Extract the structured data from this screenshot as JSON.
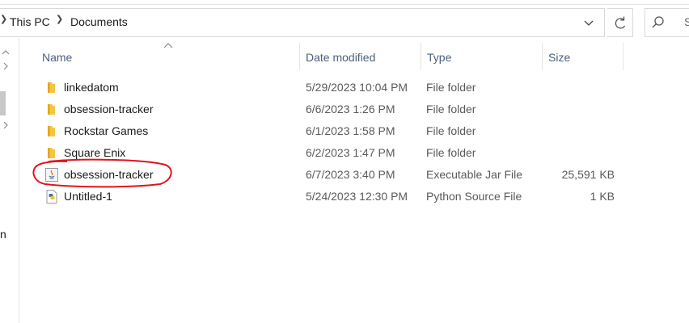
{
  "address_bar": {
    "breadcrumbs": [
      "This PC",
      "Documents"
    ]
  },
  "search": {
    "placeholder": "S"
  },
  "nav_pane": {
    "partial_letter": "n"
  },
  "columns": {
    "name": "Name",
    "date_modified": "Date modified",
    "type": "Type",
    "size": "Size"
  },
  "files": [
    {
      "name": "linkedatom",
      "date": "5/29/2023 10:04 PM",
      "type": "File folder",
      "size": "",
      "icon": "folder-icon"
    },
    {
      "name": "obsession-tracker",
      "date": "6/6/2023 1:26 PM",
      "type": "File folder",
      "size": "",
      "icon": "folder-icon"
    },
    {
      "name": "Rockstar Games",
      "date": "6/1/2023 1:58 PM",
      "type": "File folder",
      "size": "",
      "icon": "folder-icon"
    },
    {
      "name": "Square Enix",
      "date": "6/2/2023 1:47 PM",
      "type": "File folder",
      "size": "",
      "icon": "folder-icon"
    },
    {
      "name": "obsession-tracker",
      "date": "6/7/2023 3:40 PM",
      "type": "Executable Jar File",
      "size": "25,591 KB",
      "icon": "java-jar-icon"
    },
    {
      "name": "Untitled-1",
      "date": "5/24/2023 12:30 PM",
      "type": "Python Source File",
      "size": "1 KB",
      "icon": "python-file-icon"
    }
  ],
  "colors": {
    "header_text": "#4c607a",
    "folder": "#f5c542",
    "annotation": "#e0141e"
  }
}
